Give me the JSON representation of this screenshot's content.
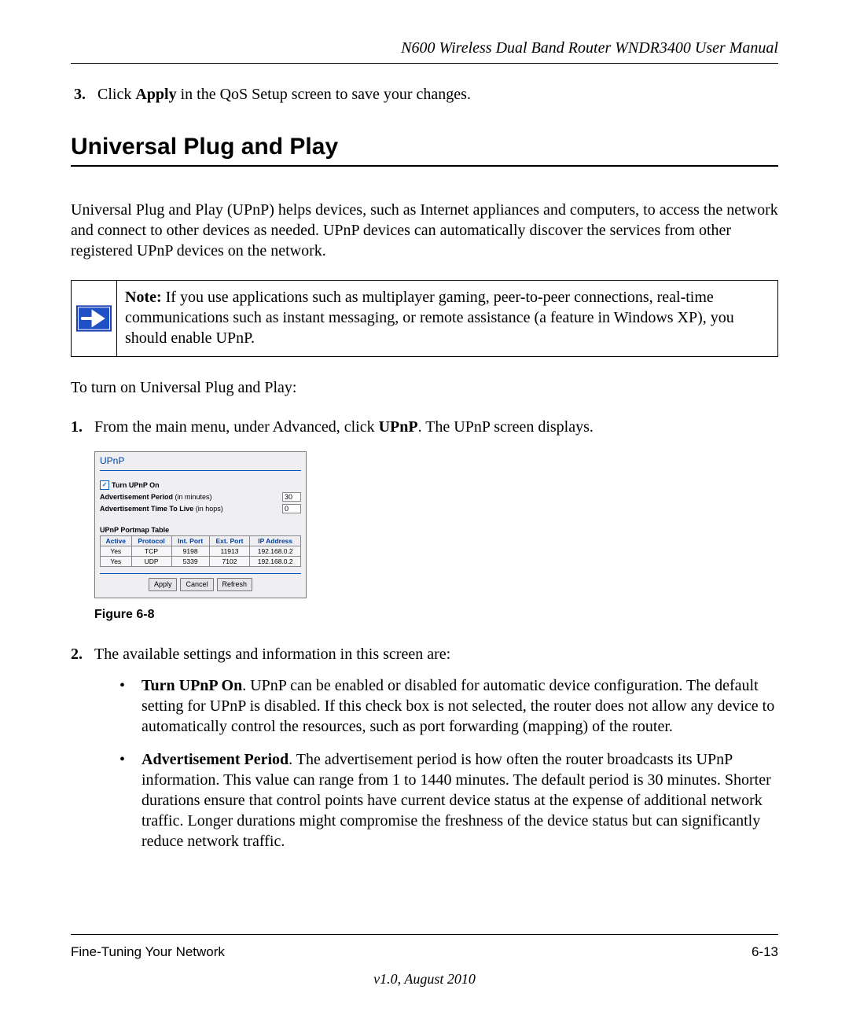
{
  "header": {
    "title": "N600 Wireless Dual Band Router WNDR3400 User Manual"
  },
  "step3": {
    "num": "3.",
    "prefix": "Click ",
    "bold": "Apply",
    "suffix": " in the QoS Setup screen to save your changes."
  },
  "section_heading": "Universal Plug and Play",
  "intro_para": "Universal Plug and Play (UPnP) helps devices, such as Internet appliances and computers, to access the network and connect to other devices as needed. UPnP devices can automatically discover the services from other registered UPnP devices on the network.",
  "note": {
    "label": "Note:",
    "text": " If you use applications such as multiplayer gaming, peer-to-peer connections, real-time communications such as instant messaging, or remote assistance (a feature in Windows XP), you should enable UPnP."
  },
  "turn_on_line": "To turn on Universal Plug and Play:",
  "step1": {
    "num": "1.",
    "prefix": "From the main menu, under Advanced, click ",
    "bold": "UPnP",
    "suffix": ". The UPnP screen displays."
  },
  "screenshot": {
    "title": "UPnP",
    "turn_on_label": "Turn UPnP On",
    "adv_period_label": "Advertisement Period",
    "adv_period_units": " (in minutes)",
    "adv_period_value": "30",
    "ttl_label": "Advertisement Time To Live",
    "ttl_units": " (in hops)",
    "ttl_value": "0",
    "table_title": "UPnP Portmap Table",
    "headers": [
      "Active",
      "Protocol",
      "Int. Port",
      "Ext. Port",
      "IP Address"
    ],
    "rows": [
      [
        "Yes",
        "TCP",
        "9198",
        "11913",
        "192.168.0.2"
      ],
      [
        "Yes",
        "UDP",
        "5339",
        "7102",
        "192.168.0.2"
      ]
    ],
    "buttons": {
      "apply": "Apply",
      "cancel": "Cancel",
      "refresh": "Refresh"
    }
  },
  "figure_label": "Figure 6-8",
  "step2": {
    "num": "2.",
    "text": "The available settings and information in this screen are:"
  },
  "bullets": [
    {
      "bold": "Turn UPnP On",
      "text": ". UPnP can be enabled or disabled for automatic device configuration. The default setting for UPnP is disabled. If this check box is not selected, the router does not allow any device to automatically control the resources, such as port forwarding (mapping) of the router."
    },
    {
      "bold": "Advertisement Period",
      "text": ". The advertisement period is how often the router broadcasts its UPnP information. This value can range from 1 to 1440 minutes. The default period is 30 minutes. Shorter durations ensure that control points have current device status at the expense of additional network traffic. Longer durations might compromise the freshness of the device status but can significantly reduce network traffic."
    }
  ],
  "footer": {
    "left": "Fine-Tuning Your Network",
    "right": "6-13",
    "version": "v1.0, August 2010"
  }
}
